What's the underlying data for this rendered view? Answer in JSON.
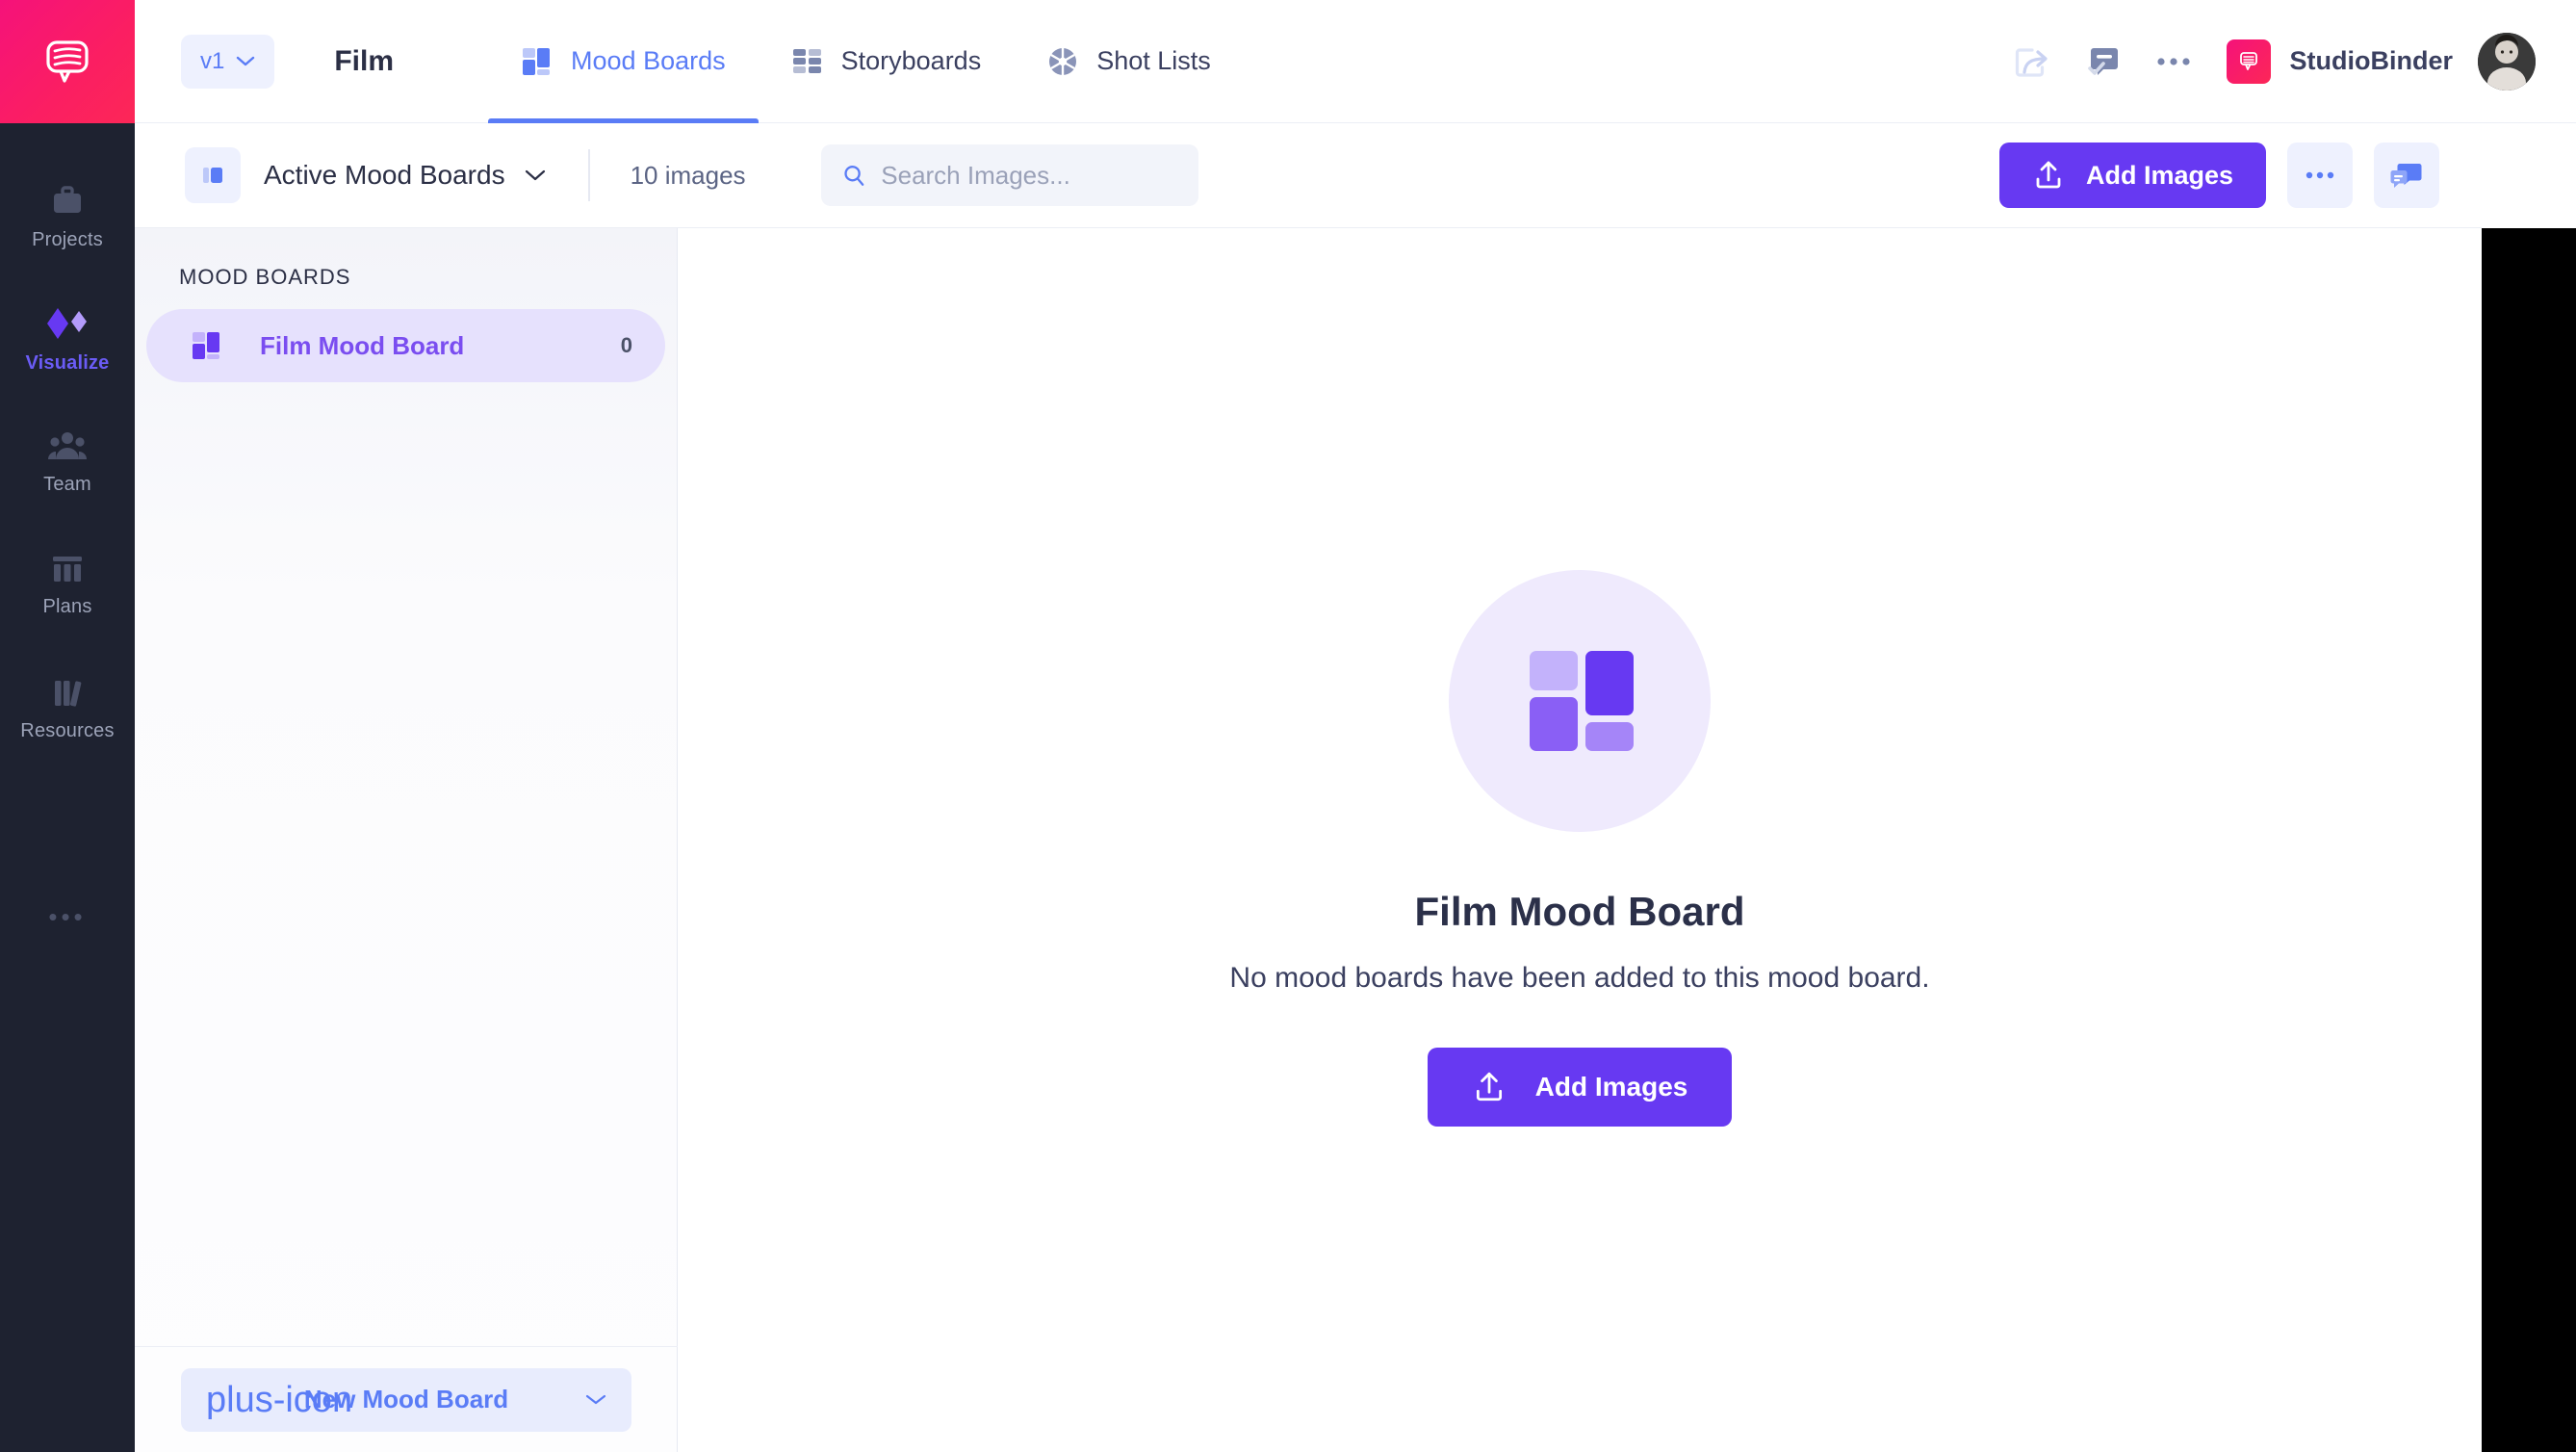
{
  "rail": {
    "logo_icon": "speech-bubble-logo-icon",
    "items": [
      {
        "label": "Projects",
        "icon": "briefcase-icon",
        "active": false
      },
      {
        "label": "Visualize",
        "icon": "diamonds-icon",
        "active": true
      },
      {
        "label": "Team",
        "icon": "people-icon",
        "active": false
      },
      {
        "label": "Plans",
        "icon": "pillars-icon",
        "active": false
      },
      {
        "label": "Resources",
        "icon": "books-icon",
        "active": false
      }
    ],
    "more_label": "•••"
  },
  "header": {
    "version_label": "v1",
    "version_chevron_icon": "chevron-down-icon",
    "project_title": "Film",
    "tabs": [
      {
        "label": "Mood Boards",
        "icon": "mood-board-icon",
        "active": true
      },
      {
        "label": "Storyboards",
        "icon": "storyboard-grid-icon",
        "active": false
      },
      {
        "label": "Shot Lists",
        "icon": "aperture-icon",
        "active": false
      }
    ],
    "share_icon": "share-icon",
    "approval_icon": "comment-check-icon",
    "more_icon": "ellipsis-icon",
    "brand_badge_icon": "studiobinder-badge-icon",
    "brand_name": "StudioBinder",
    "avatar_name": "user-avatar"
  },
  "toolbar": {
    "board_chip_icon": "mood-board-chip-icon",
    "filter_label": "Active Mood Boards",
    "filter_chevron_icon": "chevron-down-icon",
    "image_count": "10 images",
    "search": {
      "placeholder": "Search Images...",
      "value": "",
      "icon": "search-icon"
    },
    "add_images_label": "Add Images",
    "add_images_icon": "upload-icon",
    "more_icon": "ellipsis-icon",
    "comments_icon": "comments-icon"
  },
  "panel": {
    "heading": "MOOD BOARDS",
    "boards": [
      {
        "name": "Film Mood Board",
        "count": "0",
        "icon": "mood-board-icon",
        "active": true
      }
    ],
    "new_board_label": "New Mood Board",
    "new_board_plus_icon": "plus-icon",
    "new_board_chevron_icon": "chevron-down-icon"
  },
  "main": {
    "empty_icon": "mood-board-large-icon",
    "title": "Film Mood Board",
    "subtitle": "No mood boards have been added to this mood board.",
    "button_label": "Add Images",
    "button_icon": "upload-icon"
  },
  "colors": {
    "accent_purple": "#6739f2",
    "accent_blue": "#5a7cf6",
    "brand_pink": "#f5127a",
    "rail_dark": "#1e2230",
    "board_active_bg": "#e6e1fd"
  }
}
